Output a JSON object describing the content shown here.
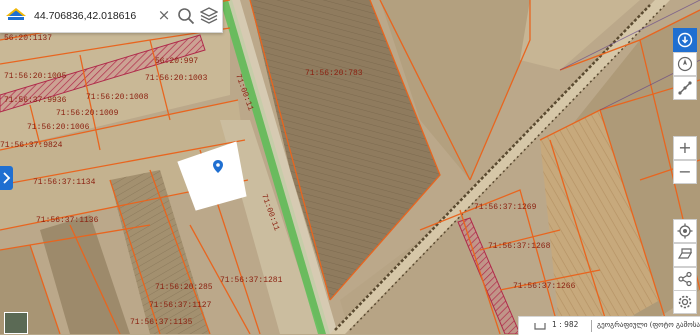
{
  "search": {
    "query": "44.706836,42.018616"
  },
  "icons": {
    "logo": "app-logo",
    "clear": "close-icon",
    "search": "search-icon",
    "layers": "layers-icon",
    "expand": "chevron-right-icon",
    "info": "info-icon",
    "measure": "compass-measure-icon",
    "draw": "draw-line-icon",
    "zoom_in": "plus-icon",
    "zoom_out": "minus-icon",
    "locate": "locate-icon",
    "print": "print-icon",
    "share": "share-icon",
    "settings": "gear-icon",
    "marker": "location-pin-icon",
    "minimap": "basemap-thumbnail"
  },
  "toolbar": {
    "zoom_in_label": "+",
    "zoom_out_label": "−"
  },
  "status": {
    "clear_label": "×",
    "scale": "1 : 982",
    "basemap": "გეოგრაფიული (ფოტო გამოსახ)"
  },
  "colors": {
    "accent": "#1f6fd1",
    "parcel_border": "#e8651f",
    "parcel_label": "#8a1f0f",
    "road_strip": "#4fc14f"
  },
  "parcels": {
    "p1": "56:20:1137",
    "p2": "56:20:997",
    "p3": "71:56:20:1005",
    "p4": "71:56:20:1003",
    "p5": "71:56:37:9936",
    "p6": "71:56:20:1008",
    "p7": "71:56:20:1009",
    "p8": "71:56:20:1006",
    "p9": "71:56:37:9824",
    "p10": "71:56:37:1134",
    "p11": "71:56:37:1136",
    "p12": "71:56:20:783",
    "p13": "71:56:37:1269",
    "p14": "71:56:37:1268",
    "p15": "71:56:37:1266",
    "p16": "71:56:37:1281",
    "p17": "71:56:20:285",
    "p18": "71:56:37:1127",
    "p19": "71:56:37:1135",
    "r1": "71:00:11",
    "r2": "71:00:11"
  }
}
